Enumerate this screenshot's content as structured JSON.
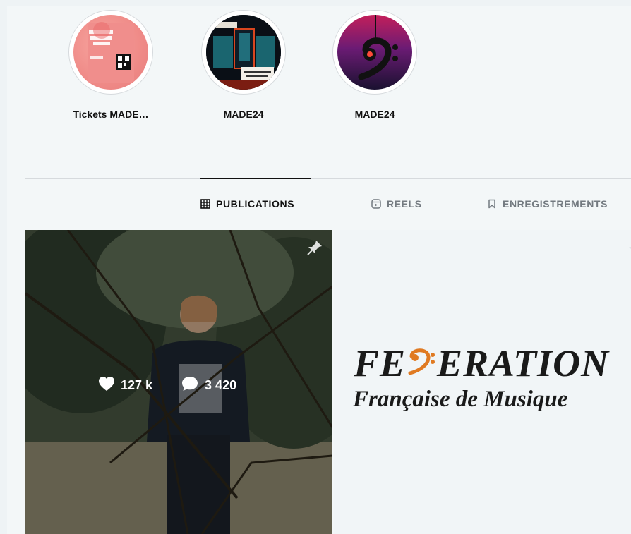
{
  "highlights": [
    {
      "label": "Tickets MADE…"
    },
    {
      "label": "MADE24"
    },
    {
      "label": "MADE24"
    }
  ],
  "tabs": [
    {
      "label": "PUBLICATIONS",
      "active": true,
      "icon": "grid-icon"
    },
    {
      "label": "REELS",
      "active": false,
      "icon": "reels-icon"
    },
    {
      "label": "ENREGISTREMENTS",
      "active": false,
      "icon": "bookmark-icon"
    }
  ],
  "posts": [
    {
      "likes": "127 k",
      "comments": "3 420",
      "pinned": true
    },
    {
      "title_left": "FE",
      "title_right": "ERATION",
      "subtitle": "Française de Musique",
      "pinned": true
    }
  ],
  "colors": {
    "background": "#f3f7f8",
    "text": "#111111",
    "inactive_tab": "#737a80",
    "accent_orange": "#e07a22"
  }
}
